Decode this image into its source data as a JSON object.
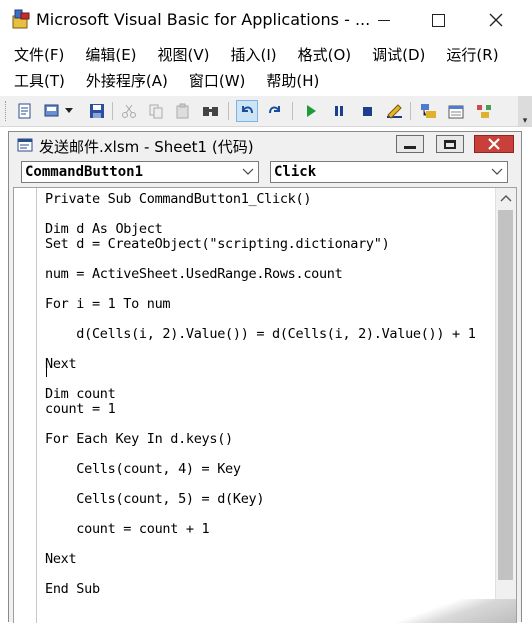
{
  "window": {
    "title": "Microsoft Visual Basic for Applications - ..."
  },
  "menu_row1": [
    "文件(F)",
    "编辑(E)",
    "视图(V)",
    "插入(I)",
    "格式(O)",
    "调试(D)",
    "运行(R)"
  ],
  "menu_row2": [
    "工具(T)",
    "外接程序(A)",
    "窗口(W)",
    "帮助(H)"
  ],
  "toolbar": {
    "icons": [
      "view-excel-icon",
      "insert-module-icon",
      "save-icon",
      "cut-icon",
      "copy-icon",
      "paste-icon",
      "find-icon",
      "undo-icon",
      "redo-icon",
      "run-icon",
      "break-icon",
      "reset-icon",
      "design-mode-icon",
      "project-explorer-icon",
      "properties-icon",
      "object-browser-icon"
    ]
  },
  "code_window": {
    "title": "发送邮件.xlsm - Sheet1 (代码)",
    "object_combo": "CommandButton1",
    "procedure_combo": "Click",
    "lines": [
      "Private Sub CommandButton1_Click()",
      "",
      "Dim d As Object",
      "Set d = CreateObject(\"scripting.dictionary\")",
      "",
      "num = ActiveSheet.UsedRange.Rows.count",
      "",
      "For i = 1 To num",
      "",
      "    d(Cells(i, 2).Value()) = d(Cells(i, 2).Value()) + 1",
      "",
      "Next",
      "",
      "Dim count",
      "count = 1",
      "",
      "For Each Key In d.keys()",
      "",
      "    Cells(count, 4) = Key",
      "",
      "    Cells(count, 5) = d(Key)",
      "",
      "    count = count + 1",
      "",
      "Next",
      "",
      "End Sub"
    ]
  },
  "colors": {
    "close_button": "#c9403a",
    "toolbar_bg": "#f0f0f0",
    "active_button_bg": "#cde4f7"
  }
}
